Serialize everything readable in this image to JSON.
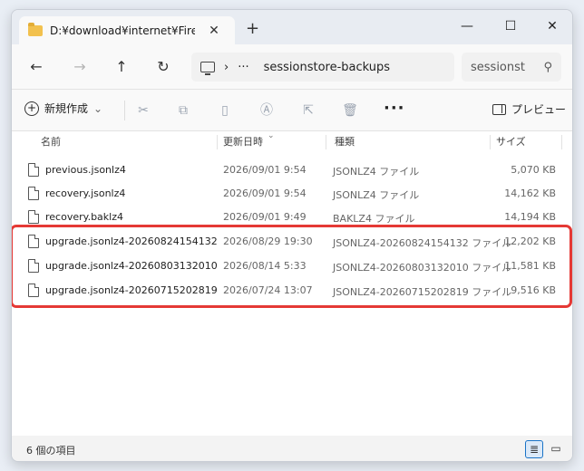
{
  "tab": {
    "title": "D:¥download¥internet¥Firefox",
    "close": "✕",
    "add": "+"
  },
  "window_controls": {
    "minimize": "—",
    "maximize": "☐",
    "close": "✕"
  },
  "nav": {
    "back": "←",
    "forward": "→",
    "up": "↑",
    "refresh": "↻",
    "breadcrumb_more": "···",
    "breadcrumb_sep": "›",
    "current_folder": "sessionstore-backups"
  },
  "search": {
    "placeholder": "sessionst",
    "icon": "⚲"
  },
  "toolbar": {
    "new_label": "新規作成",
    "new_chevron": "⌄",
    "more": "···",
    "preview_label": "プレビュー"
  },
  "columns": {
    "name": "名前",
    "date": "更新日時",
    "type": "種類",
    "size": "サイズ"
  },
  "files": [
    {
      "name": "previous.jsonlz4",
      "date": "2026/09/01 9:54",
      "type": "JSONLZ4 ファイル",
      "size": "5,070 KB"
    },
    {
      "name": "recovery.jsonlz4",
      "date": "2026/09/01 9:54",
      "type": "JSONLZ4 ファイル",
      "size": "14,162 KB"
    },
    {
      "name": "recovery.baklz4",
      "date": "2026/09/01 9:49",
      "type": "BAKLZ4 ファイル",
      "size": "14,194 KB"
    },
    {
      "name": "upgrade.jsonlz4-20260824154132",
      "date": "2026/08/29 19:30",
      "type": "JSONLZ4-20260824154132 ファイル",
      "size": "12,202 KB"
    },
    {
      "name": "upgrade.jsonlz4-20260803132010",
      "date": "2026/08/14 5:33",
      "type": "JSONLZ4-20260803132010 ファイル",
      "size": "11,581 KB"
    },
    {
      "name": "upgrade.jsonlz4-20260715202819",
      "date": "2026/07/24 13:07",
      "type": "JSONLZ4-20260715202819 ファイル",
      "size": "9,516 KB"
    }
  ],
  "status": {
    "count_text": "6 個の項目"
  },
  "colors": {
    "highlight": "#e53935",
    "accent": "#1a73c7"
  }
}
